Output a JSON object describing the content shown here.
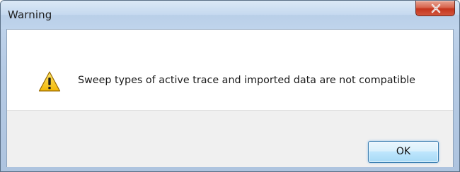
{
  "window": {
    "title": "Warning",
    "close_icon": "close-icon"
  },
  "message": {
    "icon": "warning-icon",
    "text": "Sweep types of active trace and imported data are not compatible"
  },
  "buttons": {
    "ok_label": "OK"
  },
  "colors": {
    "titlebar": "#c5d9ef",
    "close_button": "#c4351d",
    "footer": "#f0f0f0",
    "ok_button": "#bee6fd",
    "warning_yellow": "#f4c20d"
  }
}
